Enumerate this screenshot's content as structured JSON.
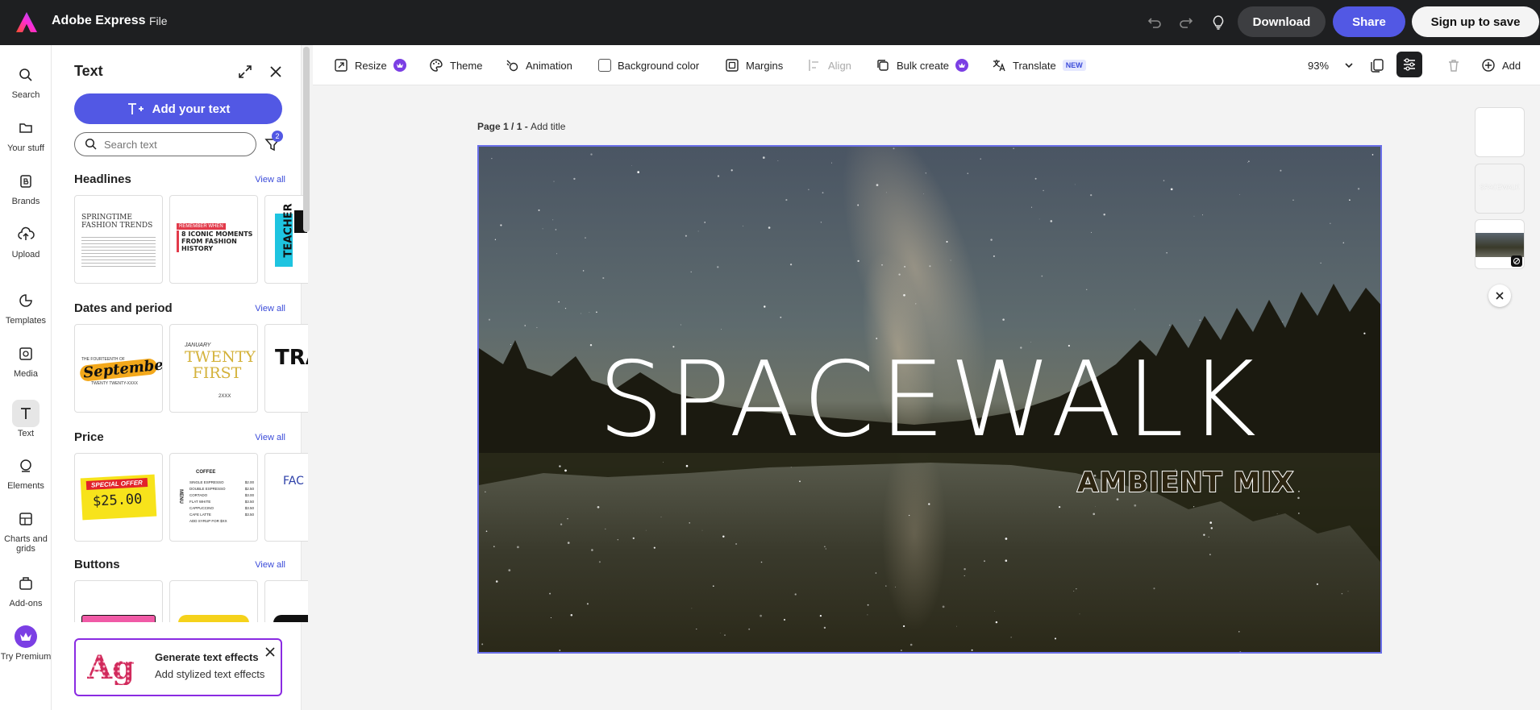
{
  "app": {
    "title": "Adobe Express",
    "file_menu": "File",
    "download": "Download",
    "share": "Share",
    "signup": "Sign up to save"
  },
  "rail": [
    {
      "label": "Search",
      "icon": "search-icon"
    },
    {
      "label": "Your stuff",
      "icon": "folder-icon"
    },
    {
      "label": "Brands",
      "icon": "brand-icon"
    },
    {
      "label": "Upload",
      "icon": "upload-icon"
    },
    {
      "label": "Templates",
      "icon": "templates-icon"
    },
    {
      "label": "Media",
      "icon": "media-icon"
    },
    {
      "label": "Text",
      "icon": "text-icon"
    },
    {
      "label": "Elements",
      "icon": "elements-icon"
    },
    {
      "label": "Charts and grids",
      "icon": "charts-icon"
    },
    {
      "label": "Add-ons",
      "icon": "addons-icon"
    },
    {
      "label": "Try Premium",
      "icon": "crown-icon"
    }
  ],
  "panel": {
    "title": "Text",
    "add_text": "Add your text",
    "search_placeholder": "Search text",
    "filter_count": "2",
    "view_all": "View all",
    "sections": [
      {
        "title": "Headlines"
      },
      {
        "title": "Dates and period"
      },
      {
        "title": "Price"
      },
      {
        "title": "Buttons"
      }
    ],
    "thumbs": {
      "fashion": "SPRINGTIME FASHION TRENDS",
      "iconic_top": "REMEMBER WHEN",
      "iconic": "8 ICONIC MOMENTS FROM FASHION HISTORY",
      "teacher": "TEACHER",
      "september_top": "THE FOURTEENTH OF",
      "september": "September",
      "september_bottom": "TWENTY TWENTY-XXXX",
      "twenty_top": "JANUARY",
      "twenty": "TWENTY FIRST",
      "twenty_bottom": "2XXX",
      "tra": "TRA",
      "special_offer": "SPECIAL OFFER",
      "price": "$25.00",
      "coffee": "COFFEE",
      "menu_items": [
        "SINGLE ESPRESSO",
        "DOUBLE ESPRESSO",
        "CORTADO",
        "FLAT WHITE",
        "CAPPUCCINO",
        "CAFE LATTE",
        "ADD SYRUP FOR $XX"
      ],
      "menu_prices": [
        "$2.00",
        "$2.50",
        "$3.00",
        "$3.50",
        "$3.50",
        "$3.50",
        ""
      ],
      "menu_side": "MENU",
      "fac": "FAC"
    },
    "generate": {
      "title": "Generate text effects",
      "subtitle": "Add stylized text effects"
    }
  },
  "toolbar": {
    "resize": "Resize",
    "theme": "Theme",
    "animation": "Animation",
    "background_color": "Background color",
    "margins": "Margins",
    "align": "Align",
    "bulk_create": "Bulk create",
    "translate": "Translate",
    "new_badge": "NEW",
    "zoom": "93%",
    "add": "Add"
  },
  "canvas": {
    "page_label": "Page 1 / 1 - ",
    "add_title": "Add title",
    "headline": "SPACEWALK",
    "subline": "AMBIENT MIX",
    "thumb_text": "SPACEWALK"
  },
  "colors": {
    "accent": "#5258e4",
    "topbar": "#1e1f21",
    "premium": "#7b3fe4"
  }
}
